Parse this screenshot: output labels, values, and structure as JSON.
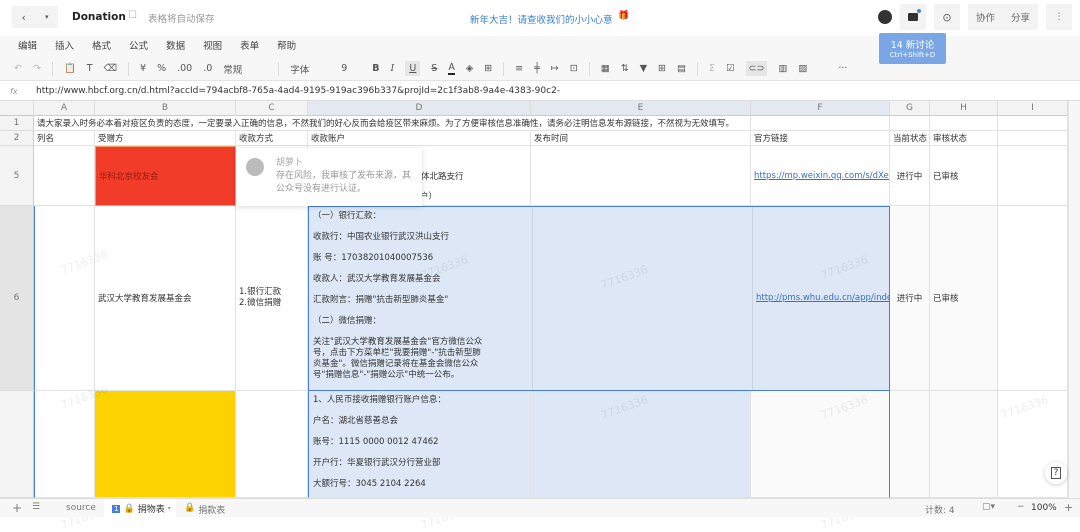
{
  "titlebar": {
    "doc_title": "Donation",
    "autosave": "表格将自动保存",
    "banner": "新年大吉！请查收我们的小小心意",
    "collab": "协作",
    "share": "分享",
    "more": "⋮"
  },
  "tooltip": {
    "title": "14 新讨论",
    "shortcut": "Ctrl+Shift+D"
  },
  "menu": [
    "编辑",
    "插入",
    "格式",
    "公式",
    "数据",
    "视图",
    "表单",
    "帮助"
  ],
  "toolbar": {
    "currency": "¥",
    "percent": "%",
    "dec_add": ".00",
    "dec_remove": ".0",
    "number_format": "常规",
    "font": "字体",
    "font_size": "9",
    "bold": "B",
    "italic": "I",
    "underline": "U",
    "strike": "S",
    "color": "A"
  },
  "formula": {
    "fx": "fx",
    "value": "http://www.hbcf.org.cn/d.html?accId=794acbf8-765a-4ad4-9195-919ac396b337&projId=2c1f3ab8-9a4e-4383-90c2-"
  },
  "columns": [
    "A",
    "B",
    "C",
    "D",
    "E",
    "F",
    "G",
    "H",
    "I"
  ],
  "rows": {
    "r1": {
      "num": "1",
      "text": "请大家录入时务必本着对疫区负责的态度，一定要录入正确的信息，不然我们的好心反而会给疫区带来麻烦。为了方便审核信息准确性，请务必注明信息发布源链接，不然视为无效填写。"
    },
    "r2": {
      "num": "2",
      "cells": [
        "列名",
        "受赠方",
        "收款方式",
        "收款账户",
        "发布时间",
        "官方链接",
        "当前状态",
        "审核状态",
        ""
      ]
    },
    "r5": {
      "num": "5",
      "recipient": "华科北京校友会",
      "account_partial": "体北路支行",
      "account_partial2": "户）",
      "link": "https://mp.weixin.qq.com/s/dXed5M",
      "status": "进行中",
      "review": "已审核"
    },
    "r6": {
      "num": "6",
      "recipient": "武汉大学教育发展基金会",
      "method": [
        "1.银行汇款",
        "2.微信捐赠"
      ],
      "account": [
        "（一）银行汇款：",
        "收款行：中国农业银行武汉洪山支行",
        "账 号：17038201040007536",
        "收款人：武汉大学教育发展基金会",
        "汇款附言：捐赠\"抗击新型肺炎基金\"",
        "（二）微信捐赠：",
        "关注\"武汉大学教育发展基金会\"官方微信公众号，点击下方菜单栏\"我要捐赠\"-\"抗击新型肺炎基金\"。微信捐赠记录将在基金会微信公众号\"捐赠信息\"-\"捐赠公示\"中统一公布。"
      ],
      "link": "http://pms.whu.edu.cn/app/index.ph",
      "status": "进行中",
      "review": "已审核"
    },
    "r7": {
      "account": [
        "1、人民币接收捐赠银行账户信息：",
        "户名：湖北省慈善总会",
        "账号：1115 0000 0012 47462",
        "开户行：华夏银行武汉分行营业部",
        "大额行号：3045 2104 2264"
      ]
    }
  },
  "comment": {
    "author": "胡萝卜",
    "text": "存在风险，我审核了发布来源，其公众号没有进行认证。"
  },
  "watermark": "7716336",
  "sheets": {
    "tabs": [
      "source",
      "捐物表",
      "捐款表"
    ],
    "active_badge": "1"
  },
  "status": {
    "count": "计数: 4",
    "zoom": "100%"
  },
  "colors": {
    "red_fill": "#f03c28",
    "yellow_fill": "#fcd200",
    "selection": "#dde7f5",
    "accent": "#4a7fd8"
  }
}
